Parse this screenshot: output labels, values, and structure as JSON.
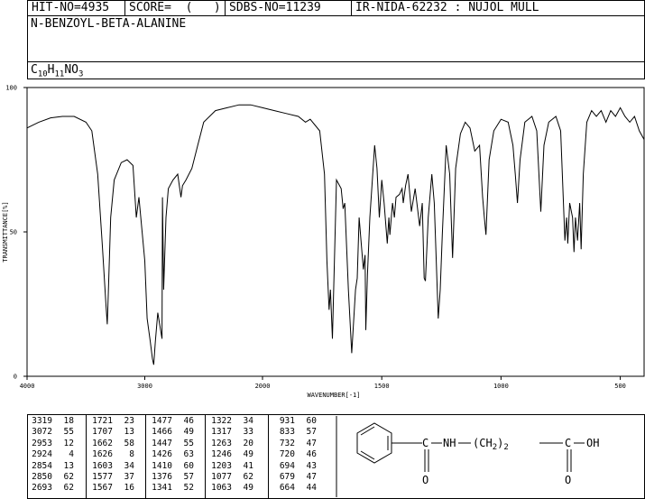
{
  "header": {
    "hit_no": "HIT-NO=4935",
    "score": "SCORE=  (   )",
    "sdbs_no": "SDBS-NO=11239",
    "ir_info": "IR-NIDA-62232 : NUJOL MULL"
  },
  "compound": {
    "name": "N-BENZOYL-BETA-ALANINE",
    "formula_parts": [
      "C",
      "10",
      "H",
      "11",
      "NO",
      "3"
    ]
  },
  "structure": {
    "labels": [
      "C",
      "NH",
      "(CH",
      "2",
      ")",
      "2",
      "C",
      "OH",
      "O",
      "O"
    ]
  },
  "chart_data": {
    "type": "line",
    "title": "",
    "xlabel": "WAVENUMBER[-1]",
    "ylabel": "TRANSMITTANCE[%]",
    "xlim": [
      4000,
      400
    ],
    "ylim": [
      0,
      100
    ],
    "x_ticks": [
      4000,
      3000,
      2000,
      1500,
      1000,
      500
    ],
    "y_ticks": [
      0,
      50,
      100
    ],
    "grid": false,
    "series": [
      {
        "name": "",
        "points": [
          [
            4000,
            86
          ],
          [
            3900,
            88
          ],
          [
            3800,
            89.5
          ],
          [
            3700,
            90
          ],
          [
            3600,
            90
          ],
          [
            3500,
            88
          ],
          [
            3450,
            85
          ],
          [
            3400,
            70
          ],
          [
            3360,
            45
          ],
          [
            3330,
            25
          ],
          [
            3319,
            18
          ],
          [
            3310,
            28
          ],
          [
            3290,
            55
          ],
          [
            3260,
            68
          ],
          [
            3200,
            74
          ],
          [
            3150,
            75
          ],
          [
            3100,
            73
          ],
          [
            3072,
            55
          ],
          [
            3050,
            62
          ],
          [
            3000,
            40
          ],
          [
            2980,
            20
          ],
          [
            2953,
            12
          ],
          [
            2935,
            6
          ],
          [
            2924,
            4
          ],
          [
            2910,
            12
          ],
          [
            2890,
            22
          ],
          [
            2870,
            17
          ],
          [
            2854,
            13
          ],
          [
            2850,
            62
          ],
          [
            2840,
            30
          ],
          [
            2820,
            55
          ],
          [
            2800,
            65
          ],
          [
            2760,
            68
          ],
          [
            2720,
            70
          ],
          [
            2693,
            62
          ],
          [
            2680,
            66
          ],
          [
            2650,
            68
          ],
          [
            2600,
            72
          ],
          [
            2550,
            80
          ],
          [
            2500,
            88
          ],
          [
            2400,
            92
          ],
          [
            2300,
            93
          ],
          [
            2200,
            94
          ],
          [
            2100,
            94
          ],
          [
            2000,
            93
          ],
          [
            1950,
            92
          ],
          [
            1900,
            91
          ],
          [
            1850,
            90
          ],
          [
            1820,
            88
          ],
          [
            1800,
            89
          ],
          [
            1760,
            85
          ],
          [
            1740,
            70
          ],
          [
            1730,
            40
          ],
          [
            1721,
            23
          ],
          [
            1715,
            30
          ],
          [
            1707,
            13
          ],
          [
            1700,
            35
          ],
          [
            1690,
            68
          ],
          [
            1670,
            65
          ],
          [
            1662,
            58
          ],
          [
            1655,
            60
          ],
          [
            1640,
            30
          ],
          [
            1626,
            8
          ],
          [
            1610,
            30
          ],
          [
            1603,
            34
          ],
          [
            1595,
            55
          ],
          [
            1585,
            45
          ],
          [
            1577,
            37
          ],
          [
            1570,
            42
          ],
          [
            1567,
            16
          ],
          [
            1560,
            35
          ],
          [
            1550,
            55
          ],
          [
            1530,
            80
          ],
          [
            1520,
            72
          ],
          [
            1510,
            55
          ],
          [
            1500,
            68
          ],
          [
            1490,
            60
          ],
          [
            1477,
            46
          ],
          [
            1470,
            55
          ],
          [
            1466,
            49
          ],
          [
            1455,
            60
          ],
          [
            1447,
            55
          ],
          [
            1440,
            62
          ],
          [
            1426,
            63
          ],
          [
            1415,
            65
          ],
          [
            1410,
            60
          ],
          [
            1400,
            66
          ],
          [
            1390,
            70
          ],
          [
            1376,
            57
          ],
          [
            1360,
            65
          ],
          [
            1341,
            52
          ],
          [
            1330,
            60
          ],
          [
            1322,
            34
          ],
          [
            1317,
            33
          ],
          [
            1305,
            55
          ],
          [
            1290,
            70
          ],
          [
            1280,
            60
          ],
          [
            1263,
            20
          ],
          [
            1255,
            30
          ],
          [
            1246,
            49
          ],
          [
            1230,
            80
          ],
          [
            1215,
            70
          ],
          [
            1203,
            41
          ],
          [
            1190,
            72
          ],
          [
            1170,
            84
          ],
          [
            1150,
            88
          ],
          [
            1130,
            86
          ],
          [
            1110,
            78
          ],
          [
            1090,
            80
          ],
          [
            1077,
            62
          ],
          [
            1070,
            55
          ],
          [
            1063,
            49
          ],
          [
            1050,
            75
          ],
          [
            1030,
            85
          ],
          [
            1000,
            89
          ],
          [
            970,
            88
          ],
          [
            950,
            80
          ],
          [
            940,
            70
          ],
          [
            931,
            60
          ],
          [
            920,
            75
          ],
          [
            900,
            88
          ],
          [
            870,
            90
          ],
          [
            850,
            85
          ],
          [
            833,
            57
          ],
          [
            820,
            80
          ],
          [
            800,
            88
          ],
          [
            770,
            90
          ],
          [
            750,
            85
          ],
          [
            732,
            47
          ],
          [
            725,
            55
          ],
          [
            720,
            46
          ],
          [
            712,
            60
          ],
          [
            700,
            55
          ],
          [
            694,
            43
          ],
          [
            688,
            55
          ],
          [
            679,
            47
          ],
          [
            670,
            60
          ],
          [
            664,
            44
          ],
          [
            655,
            70
          ],
          [
            640,
            88
          ],
          [
            620,
            92
          ],
          [
            600,
            90
          ],
          [
            580,
            92
          ],
          [
            560,
            88
          ],
          [
            540,
            92
          ],
          [
            520,
            90
          ],
          [
            500,
            93
          ],
          [
            480,
            90
          ],
          [
            460,
            88
          ],
          [
            440,
            90
          ],
          [
            420,
            85
          ],
          [
            400,
            82
          ]
        ]
      }
    ],
    "peak_table": [
      [
        [
          3319,
          18
        ],
        [
          3072,
          55
        ],
        [
          2953,
          12
        ],
        [
          2924,
          4
        ],
        [
          2854,
          13
        ],
        [
          2850,
          62
        ],
        [
          2693,
          62
        ]
      ],
      [
        [
          1721,
          23
        ],
        [
          1707,
          13
        ],
        [
          1662,
          58
        ],
        [
          1626,
          8
        ],
        [
          1603,
          34
        ],
        [
          1577,
          37
        ],
        [
          1567,
          16
        ]
      ],
      [
        [
          1477,
          46
        ],
        [
          1466,
          49
        ],
        [
          1447,
          55
        ],
        [
          1426,
          63
        ],
        [
          1410,
          60
        ],
        [
          1376,
          57
        ],
        [
          1341,
          52
        ]
      ],
      [
        [
          1322,
          34
        ],
        [
          1317,
          33
        ],
        [
          1263,
          20
        ],
        [
          1246,
          49
        ],
        [
          1203,
          41
        ],
        [
          1077,
          62
        ],
        [
          1063,
          49
        ]
      ],
      [
        [
          931,
          60
        ],
        [
          833,
          57
        ],
        [
          732,
          47
        ],
        [
          720,
          46
        ],
        [
          694,
          43
        ],
        [
          679,
          47
        ],
        [
          664,
          44
        ]
      ]
    ]
  }
}
